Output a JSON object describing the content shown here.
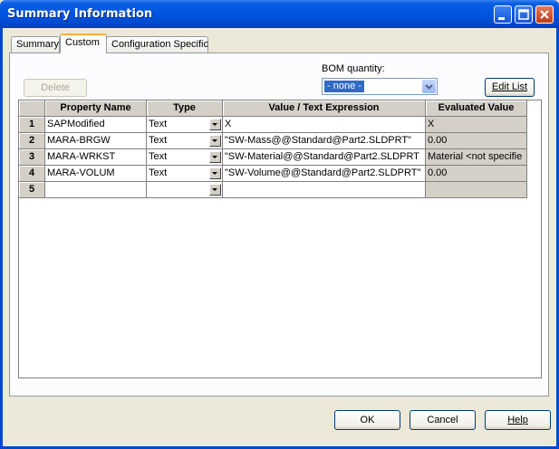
{
  "window": {
    "title": "Summary Information"
  },
  "tabs": [
    "Summary",
    "Custom",
    "Configuration Specific"
  ],
  "toolbar": {
    "delete_label": "Delete",
    "edit_list_label": "Edit List"
  },
  "bom": {
    "label": "BOM quantity:",
    "value": "- none -"
  },
  "table": {
    "headers": [
      "Property Name",
      "Type",
      "Value / Text Expression",
      "Evaluated Value"
    ],
    "rows": [
      {
        "num": "1",
        "name": "SAPModified",
        "type": "Text",
        "value": "X",
        "evaluated": "X"
      },
      {
        "num": "2",
        "name": "MARA-BRGW",
        "type": "Text",
        "value": "\"SW-Mass@@Standard@Part2.SLDPRT\"",
        "evaluated": "0.00"
      },
      {
        "num": "3",
        "name": "MARA-WRKST",
        "type": "Text",
        "value": "\"SW-Material@@Standard@Part2.SLDPRT",
        "evaluated": "Material <not specifie"
      },
      {
        "num": "4",
        "name": "MARA-VOLUM",
        "type": "Text",
        "value": "\"SW-Volume@@Standard@Part2.SLDPRT\"",
        "evaluated": "0.00"
      },
      {
        "num": "5",
        "name": "",
        "type": "",
        "value": "",
        "evaluated": ""
      }
    ]
  },
  "footer": {
    "ok_label": "OK",
    "cancel_label": "Cancel",
    "help_label": "Help"
  }
}
